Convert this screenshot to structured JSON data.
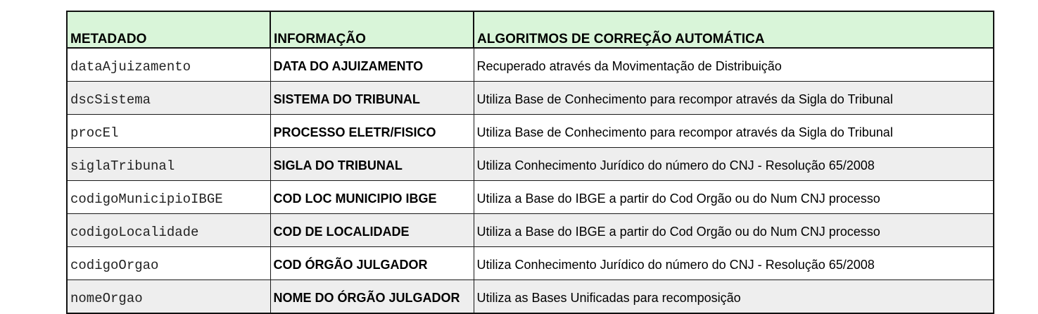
{
  "table": {
    "headers": [
      "METADADO",
      "INFORMAÇÃO",
      "ALGORITMOS DE CORREÇÃO AUTOMÁTICA"
    ],
    "rows": [
      [
        "dataAjuizamento",
        "DATA DO AJUIZAMENTO",
        "Recuperado através da Movimentação de Distribuição"
      ],
      [
        "dscSistema",
        "SISTEMA DO TRIBUNAL",
        "Utiliza Base de Conhecimento para recompor através da Sigla do Tribunal"
      ],
      [
        "procEl",
        "PROCESSO ELETR/FISICO",
        "Utiliza Base de Conhecimento para recompor através da Sigla do Tribunal"
      ],
      [
        "siglaTribunal",
        "SIGLA DO TRIBUNAL",
        "Utiliza Conhecimento Jurídico do número do CNJ - Resolução 65/2008"
      ],
      [
        "codigoMunicipioIBGE",
        "COD LOC MUNICIPIO IBGE",
        "Utiliza a Base do IBGE a partir do Cod Orgão ou do Num CNJ processo"
      ],
      [
        "codigoLocalidade",
        "COD DE LOCALIDADE",
        "Utiliza a Base do IBGE a partir do Cod Orgão ou do Num CNJ processo"
      ],
      [
        "codigoOrgao",
        "COD ÓRGÃO JULGADOR",
        "Utiliza Conhecimento Jurídico do número do CNJ - Resolução 65/2008"
      ],
      [
        "nomeOrgao",
        "NOME DO ÓRGÃO JULGADOR",
        "Utiliza as Bases Unificadas para recomposição"
      ]
    ]
  },
  "colors": {
    "header_bg": "#d9f5d9",
    "row_alt_bg": "#eeeeee",
    "border": "#1a1a1a"
  }
}
